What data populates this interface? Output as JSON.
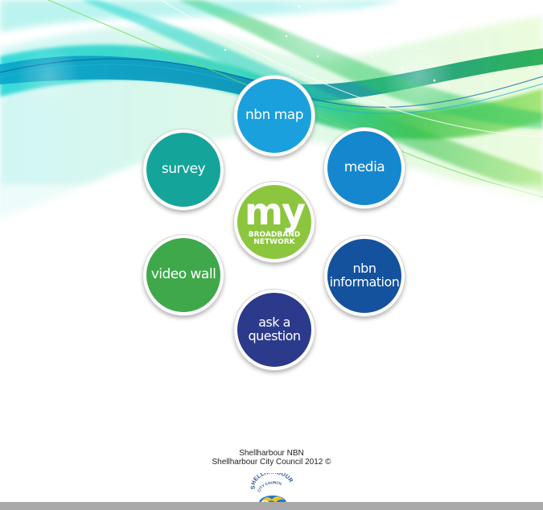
{
  "nav": {
    "nbn_map": "nbn map",
    "survey": "survey",
    "media": "media",
    "my_big": "my",
    "my_line1": "BROADBAND",
    "my_line2": "NETWORK",
    "video_wall": "video wall",
    "nbn_info_line1": "nbn",
    "nbn_info_line2": "information",
    "ask_line1": "ask a",
    "ask_line2": "question"
  },
  "footer": {
    "line1": "Shellharbour NBN",
    "line2": "Shellharbour City Council 2012 ©"
  },
  "logo": {
    "text_top": "SHELLHARBOUR",
    "text_bottom": "CITY COUNCIL"
  },
  "colors": {
    "nbn_map": "#1aa0dc",
    "survey": "#14a49a",
    "media": "#1487cf",
    "my_broadband": "#8cc63e",
    "video_wall": "#3ea84a",
    "nbn_information": "#14529e",
    "ask_question": "#2c3a8c"
  }
}
